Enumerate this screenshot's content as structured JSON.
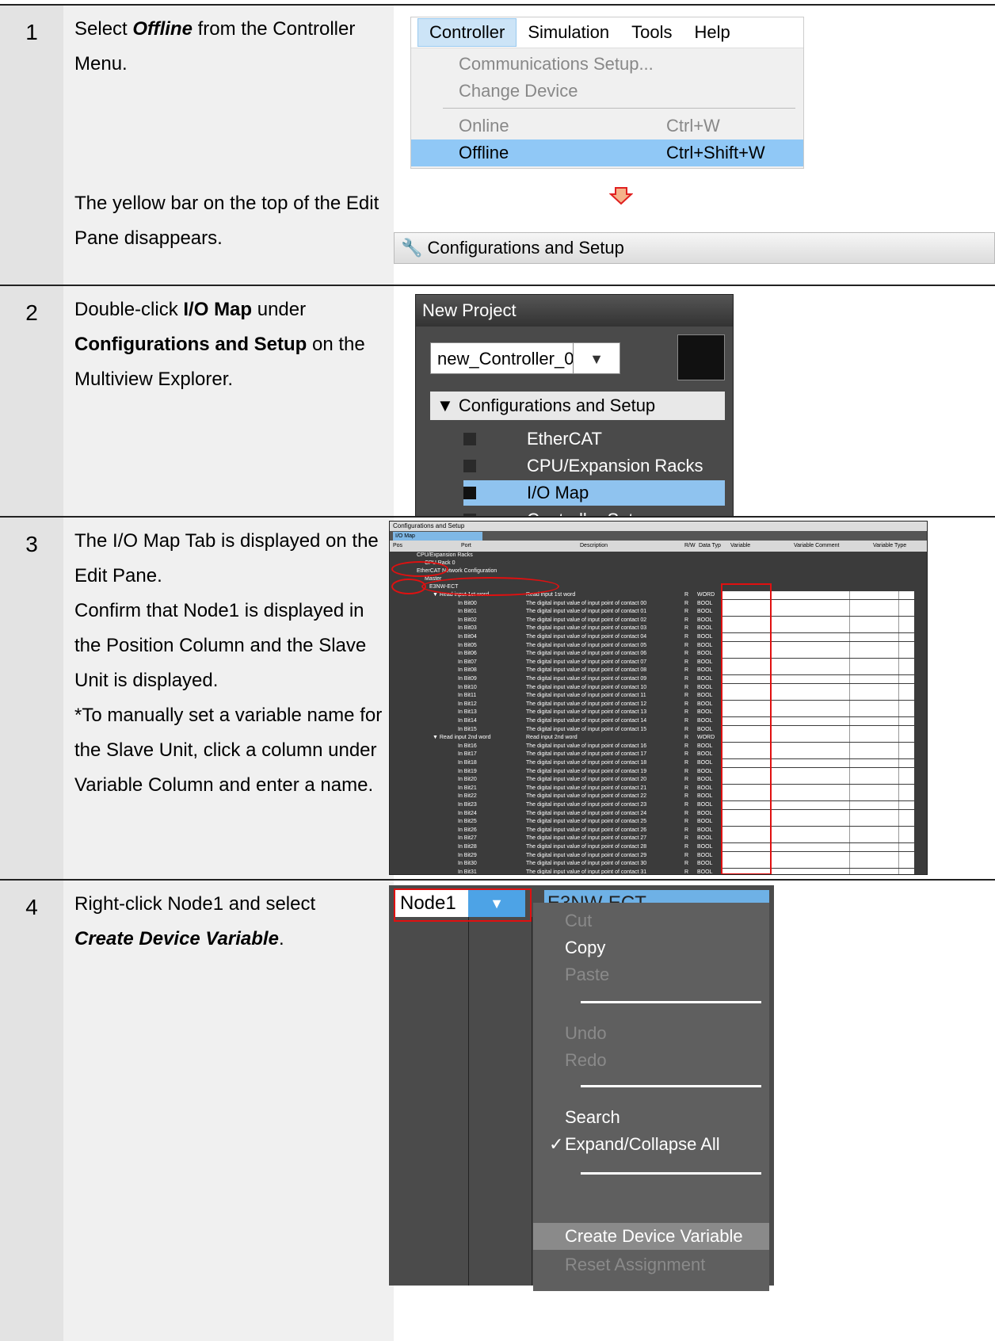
{
  "steps": [
    {
      "number": "1",
      "text_parts": [
        "Select ",
        "Offline",
        " from the Controller Menu."
      ],
      "note": "The yellow bar on the top of the Edit Pane disappears.",
      "menu": {
        "bar": [
          "Controller",
          "Simulation",
          "Tools",
          "Help"
        ],
        "items": [
          {
            "label": "Communications Setup...",
            "shortcut": ""
          },
          {
            "label": "Change Device",
            "shortcut": ""
          },
          {
            "label": "Online",
            "shortcut": "Ctrl+W"
          },
          {
            "label": "Offline",
            "shortcut": "Ctrl+Shift+W"
          }
        ]
      },
      "titlebar": "Configurations and Setup"
    },
    {
      "number": "2",
      "text_parts": [
        "Double-click ",
        "I/O Map",
        " under ",
        "Configurations and Setup",
        " on the Multiview Explorer."
      ],
      "explorer": {
        "title": "New Project",
        "controller": "new_Controller_0",
        "section": "▼ Configurations and Setup",
        "items": [
          "EtherCAT",
          "CPU/Expansion Racks",
          "I/O Map",
          "Controller Setup"
        ]
      }
    },
    {
      "number": "3",
      "text_lines": [
        "The I/O Map Tab is displayed on the Edit Pane.",
        "Confirm that Node1 is displayed in the Position Column and the Slave Unit is displayed.",
        "*To manually set a variable name for the Slave Unit, click a column under Variable Column and enter a name."
      ],
      "iomap": {
        "title": "Configurations and Setup",
        "tab": "I/O Map",
        "headers": [
          "Pos",
          "Port",
          "Description",
          "R/W",
          "Data Typ",
          "Variable",
          "Variable Comment",
          "Variable Type"
        ],
        "tree": [
          "CPU/Expansion Racks",
          "CPU Rack 0",
          "EtherCAT Network Configuration",
          "Master",
          "E3NW-ECT"
        ],
        "word1": {
          "port": "Read input 1st word",
          "desc": "Read input 1st word",
          "rw": "R",
          "type": "WORD"
        },
        "word2": {
          "port": "Read input 2nd word",
          "desc": "Read input 2nd word",
          "rw": "R",
          "type": "WORD"
        },
        "bit_desc": "The digital input value of input point of contact",
        "bits1": [
          "00",
          "01",
          "02",
          "03",
          "04",
          "05",
          "06",
          "07",
          "08",
          "09",
          "10",
          "11",
          "12",
          "13",
          "14",
          "15"
        ],
        "bits2": [
          "16",
          "17",
          "18",
          "19",
          "20",
          "21",
          "22",
          "23",
          "24",
          "25",
          "26",
          "27",
          "28",
          "29",
          "30",
          "31"
        ],
        "bit_prefix": "In Bit",
        "bit_rw": "R",
        "bit_type": "BOOL"
      }
    },
    {
      "number": "4",
      "text_parts": [
        "Right-click Node1 and select ",
        "Create Device Variable",
        "."
      ],
      "node": "Node1",
      "device": "E3NW-ECT",
      "context_menu": [
        "Cut",
        "Copy",
        "Paste",
        "Undo",
        "Redo",
        "Search",
        "Expand/Collapse All",
        "Create Device Variable",
        "Reset Assignment"
      ]
    }
  ]
}
